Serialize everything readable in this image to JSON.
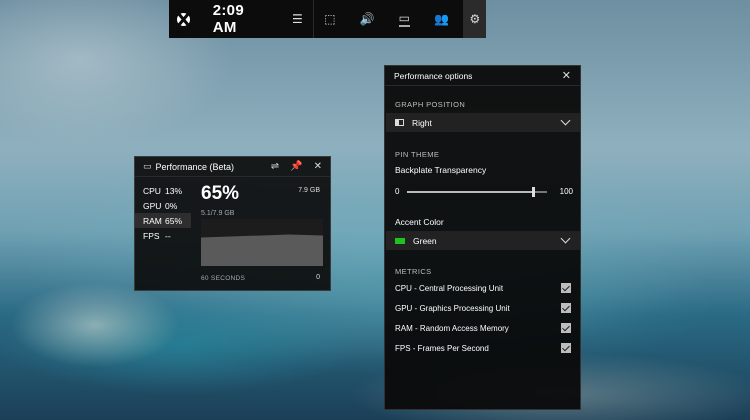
{
  "topbar": {
    "time": "2:09 AM",
    "icons": [
      "xbox-logo",
      "widget-menu-icon",
      "capture-icon",
      "audio-icon",
      "performance-icon",
      "xbox-social-icon",
      "settings-gear-icon"
    ],
    "glyphs": {
      "menu": "☰",
      "capture": "⬚",
      "audio": "🔊",
      "performance": "▭",
      "social": "👥",
      "gear": "⚙"
    }
  },
  "perf_widget": {
    "title": "Performance (Beta)",
    "icons": {
      "settings": "⇌",
      "pin": "📌",
      "close": "✕",
      "header": "▭"
    },
    "metrics": [
      {
        "label": "CPU",
        "value": "13%"
      },
      {
        "label": "GPU",
        "value": "0%"
      },
      {
        "label": "RAM",
        "value": "65%"
      },
      {
        "label": "FPS",
        "value": "--"
      }
    ],
    "selected_metric": "RAM",
    "big_value": "65%",
    "max_label": "7.9 GB",
    "sub_label": "5.1/7.9 GB",
    "x_left_label": "60 SECONDS",
    "x_right_label": "0",
    "graph_fill_fraction": 0.65
  },
  "options_panel": {
    "title": "Performance options",
    "close_glyph": "✕",
    "graph_position": {
      "section": "GRAPH POSITION",
      "value": "Right"
    },
    "pin_theme": {
      "section": "PIN THEME",
      "transparency_label": "Backplate Transparency",
      "slider_min": "0",
      "slider_max": "100",
      "slider_value": 90
    },
    "accent_color": {
      "label": "Accent Color",
      "value": "Green",
      "swatch": "#1fc21f"
    },
    "metrics": {
      "section": "METRICS",
      "items": [
        {
          "label": "CPU - Central Processing Unit",
          "checked": true
        },
        {
          "label": "GPU - Graphics Processing Unit",
          "checked": true
        },
        {
          "label": "RAM - Random Access Memory",
          "checked": true
        },
        {
          "label": "FPS - Frames Per Second",
          "checked": true
        }
      ]
    }
  }
}
